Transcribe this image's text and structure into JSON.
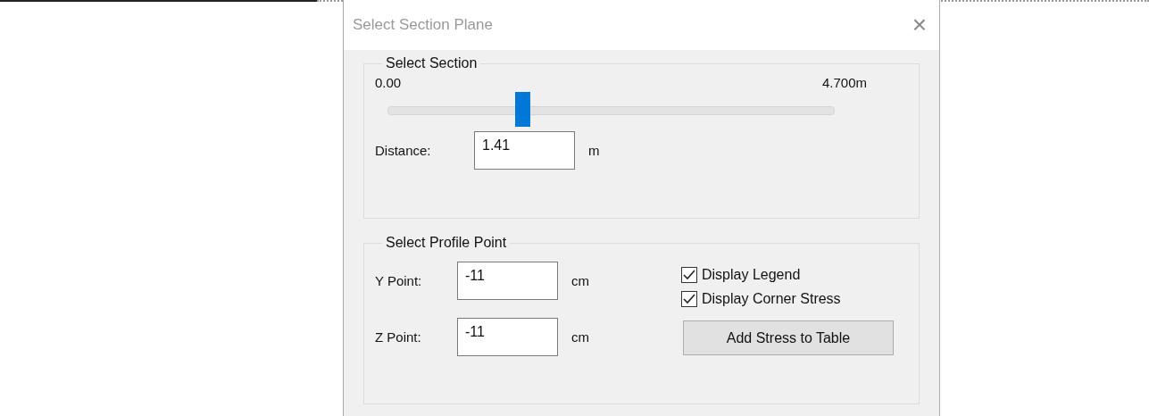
{
  "window": {
    "title": "Select Section Plane",
    "close": "×"
  },
  "section": {
    "legend": "Select Section",
    "min": "0.00",
    "max": "4.700m",
    "level": 0.3,
    "distance_label": "Distance:",
    "distance": "1.41",
    "distance_unit": "m"
  },
  "profile": {
    "legend": "Select Profile Point",
    "points": [
      {
        "label": "Y Point:",
        "value": "-11",
        "unit": "cm"
      },
      {
        "label": "Z Point:",
        "value": "-11",
        "unit": "cm"
      }
    ],
    "options": [
      {
        "label": "Display Legend",
        "checked": true
      },
      {
        "label": "Display Corner Stress",
        "checked": true
      }
    ],
    "button": "Add Stress to Table"
  }
}
